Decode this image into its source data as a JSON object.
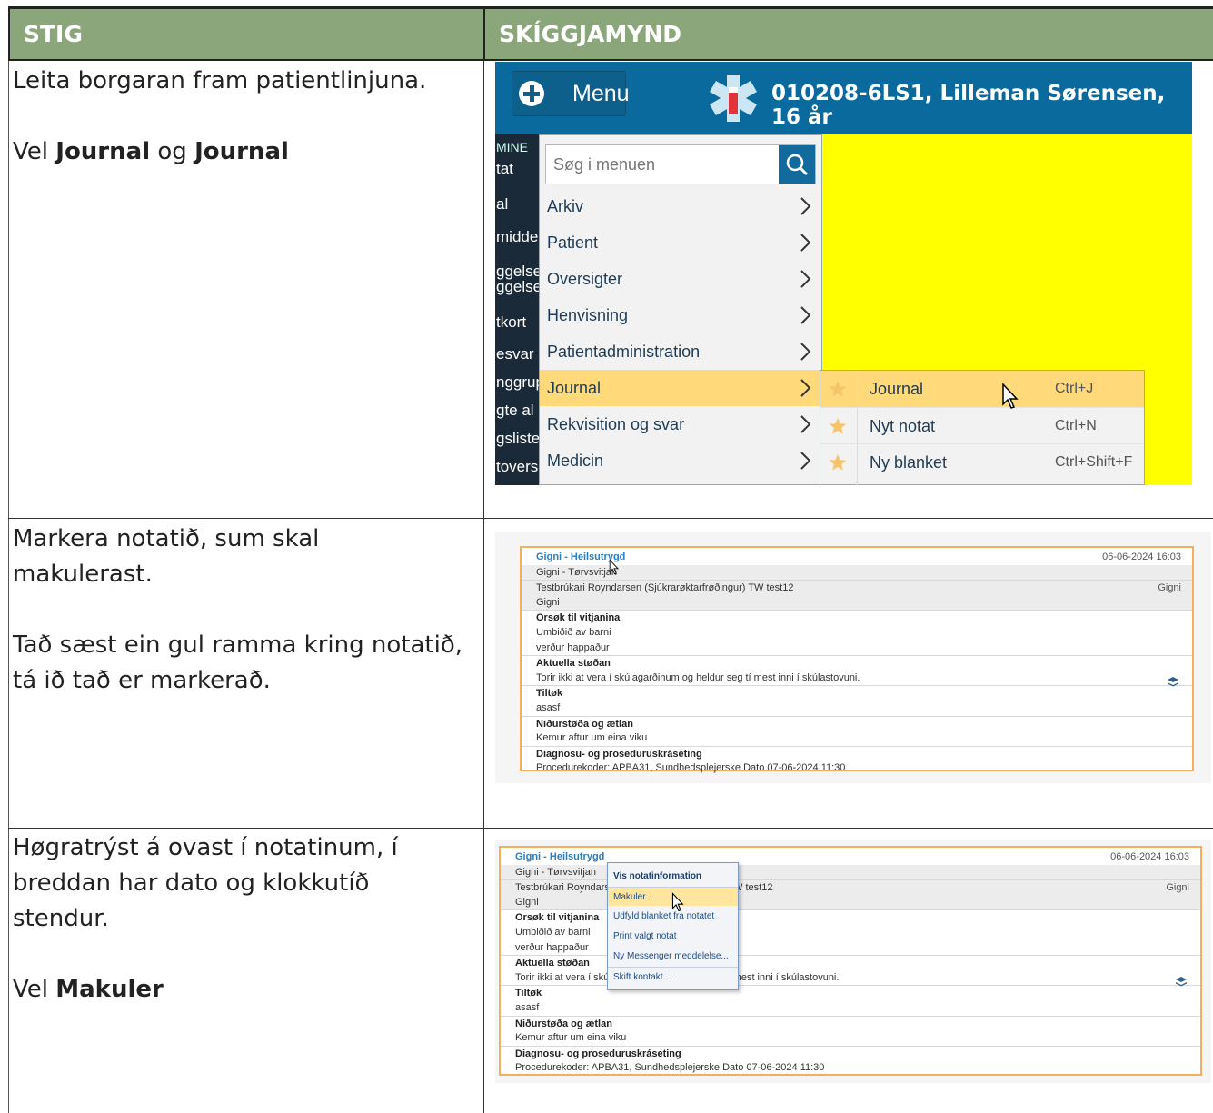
{
  "table": {
    "headers": [
      "STIG",
      "SKÍGGJAMYND"
    ],
    "rows": [
      {
        "step_lines": [
          "Leita borgaran fram patientlinjuna.",
          "",
          "Vel <b>Journal</b> og <b>Journal</b>"
        ]
      },
      {
        "step_lines": [
          "Markera notatið, sum skal",
          "makulerast.",
          "",
          "Tað sæst ein gul ramma kring notatið,",
          "tá ið tað er markerað."
        ]
      },
      {
        "step_lines": [
          "Høgratrýst á ovast í notatinum, í",
          "breddan har dato og klokkutíð",
          "stendur.",
          "",
          "Vel <b>Makuler</b>"
        ]
      }
    ]
  },
  "shot1": {
    "menu_button": "Menu",
    "patient_header": "010208-6LS1, Lilleman Sørensen, 16 år",
    "sidebar_fragments": [
      "MINE",
      "tat",
      "al",
      "midde",
      "ggelse",
      "ggelse",
      "tkort",
      "esvar",
      "nggrup",
      "gte al",
      "gsliste",
      "tovers"
    ],
    "search_placeholder": "Søg i menuen",
    "menu_items": [
      "Arkiv",
      "Patient",
      "Oversigter",
      "Henvisning",
      "Patientadministration",
      "Journal",
      "Rekvisition og svar",
      "Medicin"
    ],
    "active_menu_index": 5,
    "submenu": [
      {
        "label": "Journal",
        "shortcut": "Ctrl+J",
        "active": true
      },
      {
        "label": "Nyt notat",
        "shortcut": "Ctrl+N",
        "active": false
      },
      {
        "label": "Ny blanket",
        "shortcut": "Ctrl+Shift+F",
        "active": false
      }
    ],
    "colors": {
      "bar": "#0a6a9e",
      "highlight": "#ffd97a",
      "background": "#ffff00"
    }
  },
  "note": {
    "title": "Gigni - Heilsutrygd",
    "subtitle": "Gigni - Tørvsvitjan",
    "timestamp": "06-06-2024 16:03",
    "author": "Testbrúkari Royndarsen (Sjúkrarøktarfrøðingur) TW test12",
    "author_short_a": "Testbrúkari Roynd",
    "author_short_b": ") TW test12",
    "author_role": "Gigni",
    "category": "Gigni",
    "sections": [
      {
        "heading": "Orsøk til vitjanina",
        "lines": [
          "Umbiðið av barni",
          "verður happaður"
        ]
      },
      {
        "heading": "Aktuella støðan",
        "lines": [
          "Torir ikki at vera í skúlagarðinum og heldur seg tí mest inni í skúlastovuni."
        ]
      },
      {
        "heading": "Tiltøk",
        "lines": [
          "asasf"
        ]
      },
      {
        "heading": "Niðurstøða og ætlan",
        "lines": [
          "Kemur aftur um eina viku"
        ]
      },
      {
        "heading": "Diagnosu- og proseduruskráseting",
        "lines": [
          "Procedurekoder: APBA31, Sundhedsplejerske Dato 07-06-2024 11:30"
        ]
      }
    ],
    "clipped_a": "Torir ikki at vera í s",
    "clipped_b": "tí mest inni í skúlastovuni.",
    "clipped_aktuella": "Aktuella støðan"
  },
  "context_menu": {
    "items": [
      "Vis notatinformation",
      "Makuler...",
      "Udfyld blanket fra notatet",
      "Print valgt notat",
      "Ny Messenger meddelelse...",
      "Skift kontakt..."
    ],
    "highlighted_index": 1
  }
}
